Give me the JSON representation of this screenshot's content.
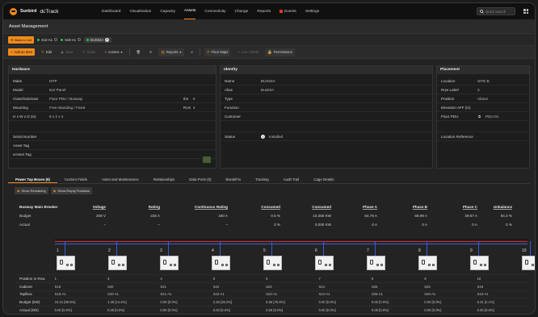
{
  "brand": {
    "name": "Sunbird",
    "product": "dcTrack"
  },
  "nav": {
    "items": [
      "Dashboard",
      "Visualization",
      "Capacity",
      "Assets",
      "Connectivity",
      "Change",
      "Reports",
      "Events",
      "Settings"
    ],
    "active": "Assets",
    "search_placeholder": "Quick Search"
  },
  "page_title": "Asset Management",
  "breadcrumb": {
    "back_label": "Back to List",
    "items": [
      "S12-A1",
      "S18-A1",
      "BUS02A"
    ]
  },
  "toolbar": {
    "add": "Add an Item",
    "edit": "Edit",
    "save": "Save",
    "clone": "Clone",
    "actions": "Actions",
    "reports": "Reports",
    "floor_maps": "Floor Maps",
    "live_charts": "Live Charts",
    "permissions": "Permissions"
  },
  "hardware": {
    "title": "Hardware",
    "rows": [
      {
        "k": "Make",
        "v": "MTP"
      },
      {
        "k": "Model",
        "v": "6x2 Panel"
      },
      {
        "k": "Class/Subclass",
        "v": "Floor PDU / Busway",
        "k2": "Ibs",
        "v2": "6"
      },
      {
        "k": "Mounting",
        "v": "Free-Standing / Fixed",
        "k2": "RUs",
        "v2": "4"
      },
      {
        "k": "H x W x D (in)",
        "v": "6 x 2 x 4"
      },
      {
        "k": "",
        "v": ""
      },
      {
        "k": "Serial Number",
        "v": ""
      },
      {
        "k": "Asset Tag",
        "v": ""
      },
      {
        "k": "eAsset Tag",
        "v": ""
      }
    ]
  },
  "identity": {
    "title": "Identity",
    "rows": [
      {
        "k": "Name",
        "v": "BUS02A"
      },
      {
        "k": "Alias",
        "v": "Bus02A"
      },
      {
        "k": "Type",
        "v": ""
      },
      {
        "k": "Function",
        "v": ""
      },
      {
        "k": "Customer",
        "v": ""
      },
      {
        "k": "",
        "v": ""
      },
      {
        "k": "Status",
        "v": "Installed"
      }
    ]
  },
  "placement": {
    "title": "Placement",
    "rows": [
      {
        "k": "Location",
        "v": "SITE B"
      },
      {
        "k": "Row Label",
        "v": "3"
      },
      {
        "k": "Position",
        "v": "Above"
      },
      {
        "k": "Elevation AFF (in)",
        "v": ""
      },
      {
        "k": "Floor PDU",
        "v": "PDU-01"
      },
      {
        "k": "",
        "v": ""
      },
      {
        "k": "Location Reference",
        "v": ""
      }
    ]
  },
  "tabs": [
    "Power Tap Boxes (9)",
    "Custom Fields",
    "Asset and Maintenance",
    "Relationships",
    "Data Ports (0)",
    "Break/Fix",
    "Tracking",
    "Audit Trail",
    "Cage Details"
  ],
  "subbar": {
    "show_remaining": "Show Remaining",
    "show_empty": "Show Empty Positions"
  },
  "breaker_table": {
    "header_label": "Busway Main Breaker",
    "columns": [
      "Voltage",
      "Rating",
      "Continuous Rating",
      "Consumed",
      "Consumed",
      "Phase A",
      "Phase B",
      "Phase C",
      "Unbalance"
    ],
    "budget_label": "Budget",
    "actual_label": "Actual",
    "budget": [
      "208 V",
      "225 A",
      "180 A",
      "0.5 %",
      "10.356 KW",
      "64.76 A",
      "69.99 A",
      "39.67 A",
      "94.4 %"
    ],
    "actual": [
      "–",
      "–",
      "–",
      "0 %",
      "0.000 KW",
      "0 A",
      "0 A",
      "0 A",
      "0 %"
    ]
  },
  "busbar_colors": {
    "black": "#111111",
    "red": "#d62828",
    "blue": "#3b5bdb"
  },
  "outlets": [
    "1",
    "2",
    "3",
    "4",
    "5",
    "6",
    "7",
    "8",
    "9",
    "10"
  ],
  "bottom_table": {
    "rows": [
      {
        "label": "Position in Row",
        "cells": [
          "1",
          "3",
          "4",
          "5",
          "6",
          "7",
          "8",
          "9",
          "10"
        ]
      },
      {
        "label": "Cabinet",
        "cells": [
          "S18",
          "S20",
          "S21",
          "S22",
          "S23",
          "S24",
          "S25",
          "S26",
          "S19"
        ]
      },
      {
        "label": "Taplbox",
        "cells": [
          "S18-A1",
          "S20-A1",
          "S21-A1",
          "S22-A1",
          "S23-A1",
          "S24-A1",
          "S25-A1",
          "S26-A1",
          "S19-A1"
        ]
      },
      {
        "label": "Budget (kW)",
        "cells": [
          "10.31 [89.5%]",
          "1.25 [14.4%]",
          "0.00 [0.0%]",
          "2.25 [26.2%]",
          "6.55 [75.8%]",
          "0.00 [0.0%]",
          "0.00 [0.0%]",
          "0.00 [0.0%]",
          "0.31 [2.1%]"
        ]
      },
      {
        "label": "Actual (kW)",
        "cells": [
          "0.00 [0.0%]",
          "0.00 [0.0%]",
          "0.00 [0.0%]",
          "0.00 [0.0%]",
          "0.00 [0.0%]",
          "0.00 [0.0%]",
          "0.00 [0.0%]",
          "0.00 [0.0%]",
          "0.00 [0.0%]"
        ]
      }
    ]
  }
}
